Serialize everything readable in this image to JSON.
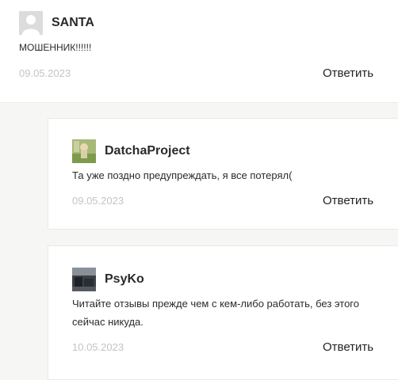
{
  "comments": [
    {
      "author": "SANTA",
      "text": "МОШЕННИК!!!!!!",
      "date": "09.05.2023",
      "reply_label": "Ответить"
    },
    {
      "author": "DatchaProject",
      "text": "Та уже поздно предупреждать, я все потерял(",
      "date": "09.05.2023",
      "reply_label": "Ответить"
    },
    {
      "author": "PsyKo",
      "text": "Читайте отзывы прежде чем с кем-либо работать, без этого сейчас никуда.",
      "date": "10.05.2023",
      "reply_label": "Ответить"
    }
  ],
  "colors": {
    "background": "#f6f6f4",
    "card": "#ffffff",
    "date": "#c4c4c4",
    "text": "#222222"
  }
}
